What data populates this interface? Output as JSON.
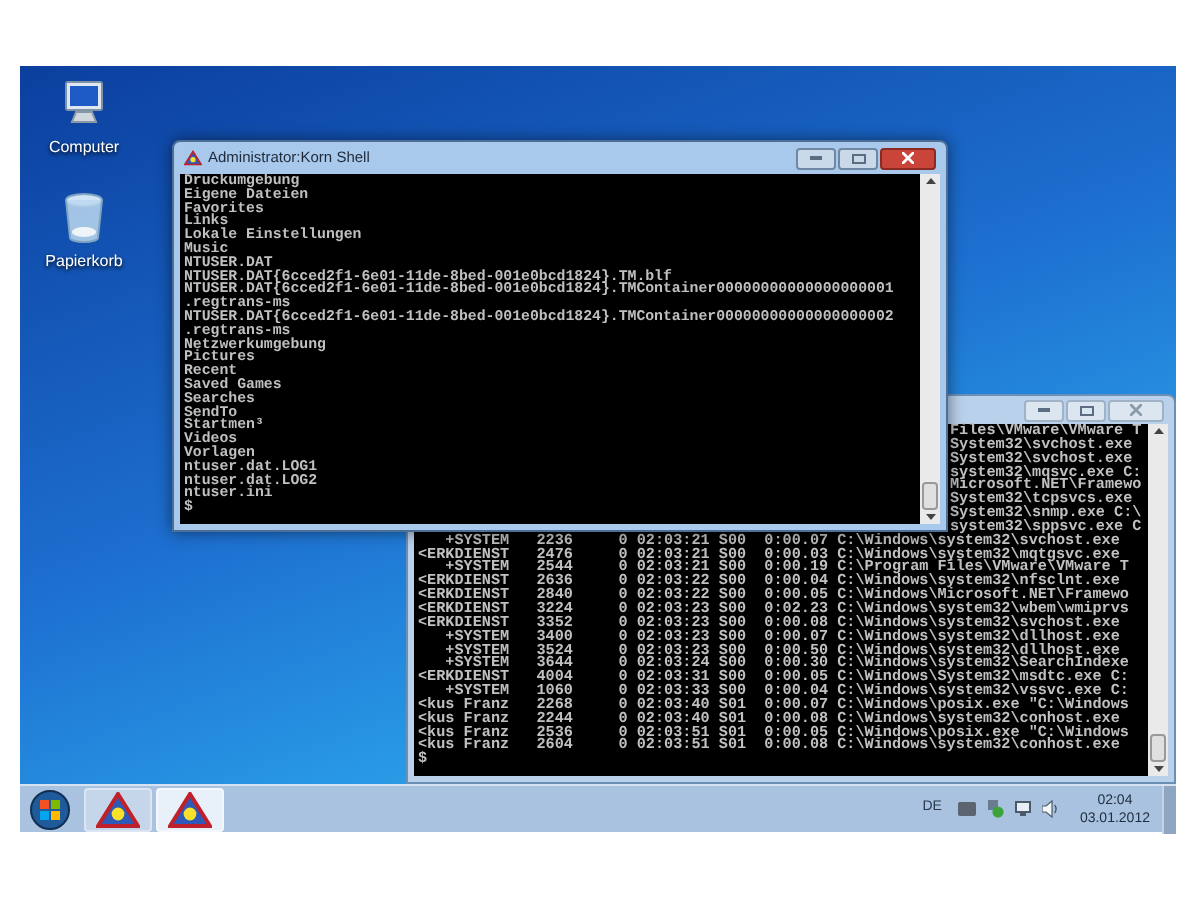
{
  "desktop": {
    "icons": [
      {
        "label": "Computer",
        "kind": "computer"
      },
      {
        "label": "Papierkorb",
        "kind": "recycle-bin"
      }
    ]
  },
  "back_window": {
    "lines": [
      {
        "kind": "covered",
        "text": "Files\\VMware\\VMware T"
      },
      {
        "kind": "covered",
        "text": "System32\\svchost.exe"
      },
      {
        "kind": "covered",
        "text": "System32\\svchost.exe"
      },
      {
        "kind": "covered",
        "text": "system32\\mqsvc.exe C:"
      },
      {
        "kind": "covered",
        "text": "Microsoft.NET\\Framewo"
      },
      {
        "kind": "covered",
        "text": "System32\\tcpsvcs.exe"
      },
      {
        "kind": "covered",
        "text": "System32\\snmp.exe C:\\"
      },
      {
        "kind": "covered",
        "text": "system32\\sppsvc.exe C"
      },
      {
        "kind": "full",
        "text": "   +SYSTEM   2236     0 02:03:21 S00  0:00.07 C:\\Windows\\system32\\svchost.exe"
      },
      {
        "kind": "full",
        "text": "<ERKDIENST   2476     0 02:03:21 S00  0:00.03 C:\\Windows\\system32\\mqtgsvc.exe"
      },
      {
        "kind": "full",
        "text": "   +SYSTEM   2544     0 02:03:21 S00  0:00.19 C:\\Program Files\\VMware\\VMware T"
      },
      {
        "kind": "full",
        "text": "<ERKDIENST   2636     0 02:03:22 S00  0:00.04 C:\\Windows\\system32\\nfsclnt.exe"
      },
      {
        "kind": "full",
        "text": "<ERKDIENST   2840     0 02:03:22 S00  0:00.05 C:\\Windows\\Microsoft.NET\\Framewo"
      },
      {
        "kind": "full",
        "text": "<ERKDIENST   3224     0 02:03:23 S00  0:02.23 C:\\Windows\\system32\\wbem\\wmiprvs"
      },
      {
        "kind": "full",
        "text": "<ERKDIENST   3352     0 02:03:23 S00  0:00.08 C:\\Windows\\system32\\svchost.exe"
      },
      {
        "kind": "full",
        "text": "   +SYSTEM   3400     0 02:03:23 S00  0:00.07 C:\\Windows\\system32\\dllhost.exe"
      },
      {
        "kind": "full",
        "text": "   +SYSTEM   3524     0 02:03:23 S00  0:00.50 C:\\Windows\\system32\\dllhost.exe"
      },
      {
        "kind": "full",
        "text": "   +SYSTEM   3644     0 02:03:24 S00  0:00.30 C:\\Windows\\system32\\SearchIndexe"
      },
      {
        "kind": "full",
        "text": "<ERKDIENST   4004     0 02:03:31 S00  0:00.05 C:\\Windows\\System32\\msdtc.exe C:"
      },
      {
        "kind": "full",
        "text": "   +SYSTEM   1060     0 02:03:33 S00  0:00.04 C:\\Windows\\system32\\vssvc.exe C:"
      },
      {
        "kind": "full",
        "text": "<kus Franz   2268     0 02:03:40 S01  0:00.07 C:\\Windows\\posix.exe \"C:\\Windows"
      },
      {
        "kind": "full",
        "text": "<kus Franz   2244     0 02:03:40 S01  0:00.08 C:\\Windows\\system32\\conhost.exe"
      },
      {
        "kind": "full",
        "text": "<kus Franz   2536     0 02:03:51 S01  0:00.05 C:\\Windows\\posix.exe \"C:\\Windows"
      },
      {
        "kind": "full",
        "text": "<kus Franz   2604     0 02:03:51 S01  0:00.08 C:\\Windows\\system32\\conhost.exe"
      },
      {
        "kind": "full",
        "text": "$"
      }
    ]
  },
  "front_window": {
    "title": "Administrator:Korn Shell",
    "lines": [
      "Druckumgebung",
      "Eigene Dateien",
      "Favorites",
      "Links",
      "Lokale Einstellungen",
      "Music",
      "NTUSER.DAT",
      "NTUSER.DAT{6cced2f1-6e01-11de-8bed-001e0bcd1824}.TM.blf",
      "NTUSER.DAT{6cced2f1-6e01-11de-8bed-001e0bcd1824}.TMContainer00000000000000000001",
      ".regtrans-ms",
      "NTUSER.DAT{6cced2f1-6e01-11de-8bed-001e0bcd1824}.TMContainer00000000000000000002",
      ".regtrans-ms",
      "Netzwerkumgebung",
      "Pictures",
      "Recent",
      "Saved Games",
      "Searches",
      "SendTo",
      "Startmen³",
      "Videos",
      "Vorlagen",
      "ntuser.dat.LOG1",
      "ntuser.dat.LOG2",
      "ntuser.ini",
      "$"
    ]
  },
  "taskbar": {
    "buttons": [
      {
        "selected": false
      },
      {
        "selected": true
      }
    ],
    "tray": {
      "language": "DE",
      "time": "02:04",
      "date": "03.01.2012"
    }
  }
}
